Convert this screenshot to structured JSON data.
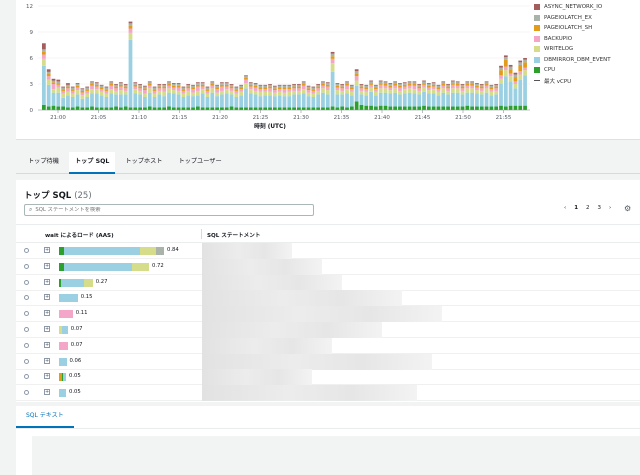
{
  "chart_data": {
    "type": "bar",
    "stacked": true,
    "xlabel": "時刻 (UTC)",
    "x_ticks": [
      "21:00",
      "21:05",
      "21:10",
      "21:15",
      "21:20",
      "21:25",
      "21:30",
      "21:35",
      "21:40",
      "21:45",
      "21:50",
      "21:55"
    ],
    "y_ticks": [
      0,
      3,
      6,
      9,
      12
    ],
    "ylim": [
      0,
      12
    ],
    "legend_position": "right",
    "series_order": [
      "CPU",
      "DBMIRROR_DBM_EVENT",
      "WRITELOG",
      "BACKUPIO",
      "PAGEIOLATCH_SH",
      "PAGEIOLATCH_EX",
      "ASYNC_NETWORK_IO"
    ],
    "series": [
      {
        "name": "CPU",
        "color": "#2ca02c",
        "values": [
          0.6,
          0.4,
          0.5,
          0.4,
          0.4,
          0.3,
          0.3,
          0.4,
          0.3,
          0.3,
          0.4,
          0.3,
          0.3,
          0.3,
          0.3,
          0.4,
          0.3,
          0.4,
          0.3,
          0.3,
          0.3,
          0.3,
          0.4,
          0.3,
          0.3,
          0.3,
          0.4,
          0.3,
          0.3,
          0.3,
          0.3,
          0.3,
          0.4,
          0.3,
          0.3,
          0.3,
          0.3,
          0.3,
          0.3,
          0.4,
          0.3,
          0.3,
          0.3,
          0.3,
          0.3,
          0.3,
          0.3,
          0.3,
          0.3,
          0.3,
          0.3,
          0.3,
          0.3,
          0.3,
          0.3,
          0.3,
          0.3,
          0.3,
          0.3,
          0.3,
          0.4,
          0.3,
          0.4,
          0.3,
          0.4,
          1.0,
          0.6,
          0.5,
          0.5,
          0.4,
          0.5,
          0.5,
          0.4,
          0.4,
          0.4,
          0.4,
          0.4,
          0.4,
          0.4,
          0.5,
          0.4,
          0.4,
          0.4,
          0.4,
          0.4,
          0.4,
          0.4,
          0.4,
          0.5,
          0.4,
          0.4,
          0.4,
          0.4,
          0.4,
          0.4,
          0.5,
          0.4,
          0.5,
          0.5,
          0.5,
          0.5
        ]
      },
      {
        "name": "DBMIRROR_DBM_EVENT",
        "color": "#9ad0e2",
        "values": [
          4.5,
          2.5,
          1.5,
          1.6,
          1.0,
          1.4,
          1.2,
          1.4,
          1.0,
          1.2,
          1.5,
          1.6,
          1.4,
          1.2,
          1.6,
          1.4,
          1.5,
          1.4,
          7.8,
          1.6,
          1.5,
          1.2,
          1.6,
          1.2,
          1.5,
          1.3,
          1.6,
          1.6,
          1.5,
          1.2,
          1.4,
          1.3,
          1.3,
          1.6,
          1.2,
          1.7,
          1.3,
          1.5,
          1.6,
          1.4,
          1.2,
          1.4,
          2.2,
          1.6,
          1.5,
          1.3,
          1.4,
          1.4,
          1.3,
          1.4,
          1.3,
          1.3,
          1.5,
          1.5,
          1.6,
          1.3,
          1.2,
          1.5,
          1.7,
          1.5,
          4.0,
          1.5,
          1.4,
          1.6,
          1.3,
          1.8,
          1.2,
          1.2,
          1.6,
          1.3,
          1.5,
          1.5,
          1.5,
          1.6,
          1.4,
          1.5,
          1.6,
          1.5,
          1.4,
          1.6,
          1.5,
          1.5,
          1.3,
          1.6,
          1.4,
          1.6,
          1.6,
          1.4,
          1.5,
          1.6,
          1.5,
          1.4,
          1.6,
          1.3,
          1.4,
          2.5,
          3.5,
          2.8,
          2.0,
          3.0,
          3.5
        ]
      },
      {
        "name": "WRITELOG",
        "color": "#d6dd8a",
        "values": [
          0.8,
          0.6,
          0.4,
          0.6,
          0.5,
          0.4,
          0.4,
          0.5,
          0.4,
          0.4,
          0.5,
          0.5,
          0.4,
          0.4,
          0.5,
          0.4,
          0.5,
          0.4,
          0.8,
          0.5,
          0.4,
          0.4,
          0.5,
          0.4,
          0.4,
          0.5,
          0.5,
          0.4,
          0.4,
          0.4,
          0.5,
          0.4,
          0.5,
          0.5,
          0.4,
          0.5,
          0.4,
          0.4,
          0.5,
          0.4,
          0.4,
          0.4,
          0.6,
          0.5,
          0.4,
          0.5,
          0.4,
          0.4,
          0.4,
          0.4,
          0.4,
          0.5,
          0.4,
          0.4,
          0.5,
          0.4,
          0.4,
          0.4,
          0.5,
          0.5,
          1.0,
          0.5,
          0.4,
          0.5,
          0.4,
          0.6,
          0.4,
          0.4,
          0.5,
          0.4,
          0.5,
          0.5,
          0.4,
          0.5,
          0.4,
          0.5,
          0.5,
          0.5,
          0.4,
          0.5,
          0.4,
          0.5,
          0.4,
          0.5,
          0.4,
          0.5,
          0.5,
          0.4,
          0.5,
          0.5,
          0.4,
          0.4,
          0.5,
          0.4,
          0.4,
          0.6,
          0.7,
          0.6,
          0.5,
          0.6,
          0.6
        ]
      },
      {
        "name": "BACKUPIO",
        "color": "#f4a6c8",
        "values": [
          0.5,
          0.4,
          0.6,
          0.3,
          0.3,
          0.4,
          0.3,
          0.3,
          0.3,
          0.3,
          0.4,
          0.3,
          0.3,
          0.3,
          0.4,
          0.3,
          0.4,
          0.3,
          0.5,
          0.3,
          0.3,
          0.4,
          0.3,
          0.3,
          0.3,
          0.4,
          0.3,
          0.3,
          0.4,
          0.3,
          0.3,
          0.4,
          0.5,
          0.3,
          0.3,
          0.3,
          0.4,
          0.5,
          0.3,
          0.3,
          0.3,
          0.3,
          0.4,
          0.3,
          0.4,
          0.3,
          0.3,
          0.4,
          0.3,
          0.3,
          0.4,
          0.3,
          0.3,
          0.3,
          0.4,
          0.3,
          0.3,
          0.3,
          0.3,
          0.4,
          0.5,
          0.3,
          0.3,
          0.4,
          0.3,
          0.5,
          0.3,
          0.3,
          0.3,
          0.3,
          0.4,
          0.3,
          0.3,
          0.3,
          0.4,
          0.3,
          0.3,
          0.4,
          0.3,
          0.3,
          0.3,
          0.3,
          0.3,
          0.3,
          0.3,
          0.4,
          0.3,
          0.3,
          0.3,
          0.3,
          0.3,
          0.3,
          0.3,
          0.3,
          0.3,
          0.4,
          0.4,
          0.3,
          0.3,
          0.4,
          0.3
        ]
      },
      {
        "name": "PAGEIOLATCH_SH",
        "color": "#e39c1a",
        "values": [
          0.3,
          0.3,
          0.2,
          0.2,
          0.2,
          0.2,
          0.2,
          0.2,
          0.2,
          0.2,
          0.2,
          0.2,
          0.2,
          0.2,
          0.2,
          0.2,
          0.2,
          0.2,
          0.3,
          0.2,
          0.2,
          0.2,
          0.2,
          0.2,
          0.2,
          0.2,
          0.2,
          0.2,
          0.2,
          0.2,
          0.2,
          0.2,
          0.2,
          0.2,
          0.2,
          0.2,
          0.2,
          0.2,
          0.2,
          0.2,
          0.2,
          0.2,
          0.2,
          0.2,
          0.2,
          0.2,
          0.2,
          0.2,
          0.2,
          0.2,
          0.2,
          0.2,
          0.2,
          0.2,
          0.2,
          0.2,
          0.2,
          0.2,
          0.2,
          0.2,
          0.3,
          0.2,
          0.2,
          0.2,
          0.2,
          0.3,
          0.2,
          0.2,
          0.2,
          0.2,
          0.2,
          0.2,
          0.2,
          0.2,
          0.2,
          0.2,
          0.2,
          0.2,
          0.2,
          0.2,
          0.2,
          0.2,
          0.2,
          0.2,
          0.2,
          0.2,
          0.2,
          0.2,
          0.2,
          0.2,
          0.2,
          0.2,
          0.2,
          0.2,
          0.2,
          0.6,
          0.8,
          0.5,
          0.5,
          0.7,
          0.6
        ]
      },
      {
        "name": "PAGEIOLATCH_EX",
        "color": "#a9b3a9",
        "values": [
          0.3,
          0.2,
          0.2,
          0.2,
          0.2,
          0.2,
          0.2,
          0.2,
          0.2,
          0.2,
          0.2,
          0.2,
          0.2,
          0.2,
          0.2,
          0.2,
          0.2,
          0.2,
          0.3,
          0.2,
          0.2,
          0.2,
          0.2,
          0.2,
          0.2,
          0.2,
          0.2,
          0.2,
          0.2,
          0.2,
          0.2,
          0.2,
          0.2,
          0.2,
          0.2,
          0.2,
          0.2,
          0.2,
          0.2,
          0.2,
          0.2,
          0.2,
          0.2,
          0.2,
          0.2,
          0.2,
          0.2,
          0.2,
          0.2,
          0.2,
          0.2,
          0.2,
          0.2,
          0.2,
          0.2,
          0.2,
          0.2,
          0.2,
          0.2,
          0.2,
          0.3,
          0.2,
          0.2,
          0.2,
          0.2,
          0.3,
          0.2,
          0.2,
          0.2,
          0.2,
          0.2,
          0.2,
          0.2,
          0.2,
          0.2,
          0.2,
          0.2,
          0.2,
          0.2,
          0.2,
          0.2,
          0.2,
          0.2,
          0.2,
          0.2,
          0.2,
          0.2,
          0.2,
          0.2,
          0.2,
          0.2,
          0.2,
          0.2,
          0.2,
          0.2,
          0.3,
          0.3,
          0.3,
          0.3,
          0.3,
          0.3
        ]
      },
      {
        "name": "ASYNC_NETWORK_IO",
        "color": "#a45d5d",
        "values": [
          0.7,
          0.3,
          0.2,
          0.2,
          0.1,
          0.2,
          0.1,
          0.1,
          0.1,
          0.1,
          0.1,
          0.1,
          0.1,
          0.1,
          0.1,
          0.1,
          0.1,
          0.1,
          0.2,
          0.1,
          0.1,
          0.1,
          0.1,
          0.1,
          0.1,
          0.1,
          0.1,
          0.1,
          0.1,
          0.1,
          0.1,
          0.1,
          0.1,
          0.1,
          0.1,
          0.1,
          0.1,
          0.1,
          0.1,
          0.1,
          0.1,
          0.1,
          0.1,
          0.1,
          0.1,
          0.1,
          0.1,
          0.1,
          0.1,
          0.1,
          0.1,
          0.1,
          0.1,
          0.1,
          0.1,
          0.1,
          0.1,
          0.1,
          0.1,
          0.1,
          0.2,
          0.1,
          0.1,
          0.1,
          0.1,
          0.2,
          0.1,
          0.1,
          0.1,
          0.1,
          0.1,
          0.1,
          0.1,
          0.1,
          0.1,
          0.1,
          0.1,
          0.1,
          0.1,
          0.1,
          0.1,
          0.1,
          0.1,
          0.1,
          0.1,
          0.1,
          0.1,
          0.1,
          0.1,
          0.1,
          0.1,
          0.1,
          0.1,
          0.1,
          0.1,
          0.2,
          0.2,
          0.2,
          0.2,
          0.2,
          0.2
        ]
      }
    ],
    "legend": [
      {
        "name": "ASYNC_NETWORK_IO",
        "color": "#a45d5d",
        "style": "box"
      },
      {
        "name": "PAGEIOLATCH_EX",
        "color": "#a9b3a9",
        "style": "box"
      },
      {
        "name": "PAGEIOLATCH_SH",
        "color": "#e39c1a",
        "style": "box"
      },
      {
        "name": "BACKUPIO",
        "color": "#f4a6c8",
        "style": "box"
      },
      {
        "name": "WRITELOG",
        "color": "#d6dd8a",
        "style": "box"
      },
      {
        "name": "DBMIRROR_DBM_EVENT",
        "color": "#9ad0e2",
        "style": "box"
      },
      {
        "name": "CPU",
        "color": "#2ca02c",
        "style": "box"
      },
      {
        "name": "最大 vCPU",
        "color": "#555555",
        "style": "dash"
      }
    ]
  },
  "tabs": [
    {
      "label": "トップ待機",
      "active": false
    },
    {
      "label": "トップ SQL",
      "active": true
    },
    {
      "label": "トップホスト",
      "active": false
    },
    {
      "label": "トップユーザー",
      "active": false
    }
  ],
  "sql": {
    "title": "トップ SQL",
    "count": "(25)",
    "search_placeholder": "SQL ステートメントを検索",
    "pages": [
      "1",
      "2",
      "3"
    ],
    "current_page": "1",
    "col_load": "wait によるロード (AAS)",
    "col_statement": "SQL ステートメント",
    "rows": [
      {
        "value": "0.84",
        "segments": [
          {
            "c": "#2ca02c",
            "w": 0.05
          },
          {
            "c": "#9ad0e2",
            "w": 0.72
          },
          {
            "c": "#d6dd8a",
            "w": 0.15
          },
          {
            "c": "#a9b3a9",
            "w": 0.08
          }
        ],
        "blur": 90
      },
      {
        "value": "0.72",
        "segments": [
          {
            "c": "#2ca02c",
            "w": 0.06
          },
          {
            "c": "#9ad0e2",
            "w": 0.75
          },
          {
            "c": "#d6dd8a",
            "w": 0.19
          }
        ],
        "blur": 120
      },
      {
        "value": "0.27",
        "segments": [
          {
            "c": "#2ca02c",
            "w": 0.05
          },
          {
            "c": "#9ad0e2",
            "w": 0.7
          },
          {
            "c": "#d6dd8a",
            "w": 0.25
          }
        ],
        "blur": 140
      },
      {
        "value": "0.15",
        "segments": [
          {
            "c": "#9ad0e2",
            "w": 1.0
          }
        ],
        "blur": 200
      },
      {
        "value": "0.11",
        "segments": [
          {
            "c": "#f4a6c8",
            "w": 1.0
          }
        ],
        "blur": 240
      },
      {
        "value": "0.07",
        "segments": [
          {
            "c": "#d6dd8a",
            "w": 0.3
          },
          {
            "c": "#9ad0e2",
            "w": 0.7
          }
        ],
        "blur": 180
      },
      {
        "value": "0.07",
        "segments": [
          {
            "c": "#f4a6c8",
            "w": 1.0
          }
        ],
        "blur": 130
      },
      {
        "value": "0.06",
        "segments": [
          {
            "c": "#9ad0e2",
            "w": 1.0
          }
        ],
        "blur": 230
      },
      {
        "value": "0.05",
        "segments": [
          {
            "c": "#e39c1a",
            "w": 0.4
          },
          {
            "c": "#2ca02c",
            "w": 0.2
          },
          {
            "c": "#9ad0e2",
            "w": 0.4
          }
        ],
        "blur": 110
      },
      {
        "value": "0.05",
        "segments": [
          {
            "c": "#9ad0e2",
            "w": 1.0
          }
        ],
        "blur": 215
      }
    ]
  },
  "text_panel": {
    "tab_label": "SQL テキスト"
  }
}
